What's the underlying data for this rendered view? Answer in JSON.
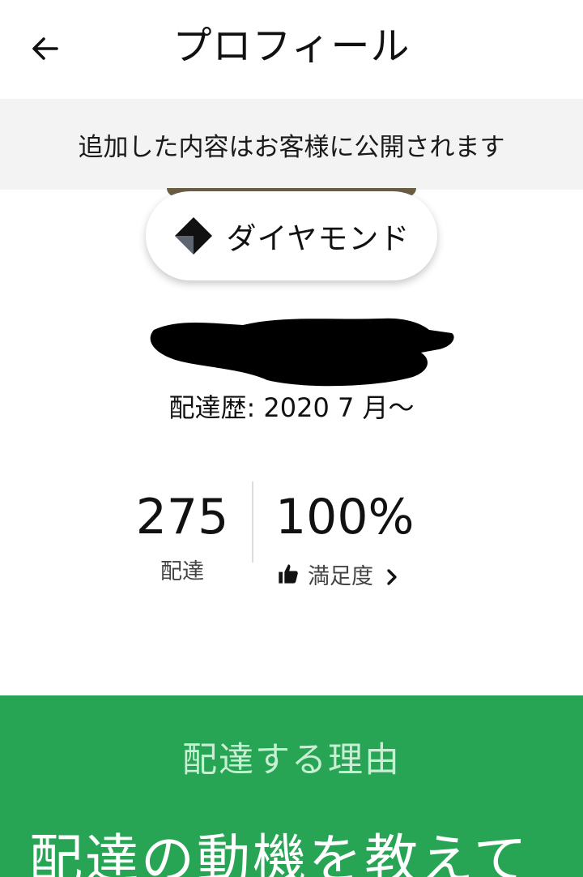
{
  "header": {
    "title": "プロフィール",
    "back_icon": "arrow-left-icon"
  },
  "notice": {
    "text": "追加した内容はお客様に公開されます"
  },
  "tier": {
    "label": "ダイヤモンド",
    "icon": "diamond-icon"
  },
  "profile": {
    "since": "配達歴: 2020 7 月〜"
  },
  "stats": {
    "deliveries": {
      "value": "275",
      "label": "配達"
    },
    "satisfaction": {
      "value": "100%",
      "label": "満足度",
      "icon": "thumbs-up-icon",
      "chevron_icon": "chevron-right-icon"
    }
  },
  "reason": {
    "subtitle": "配達する理由",
    "heading": "配達の動機を教えて"
  },
  "colors": {
    "green": "#27a554",
    "notice_bg": "#f3f3f3",
    "subtitle_green": "#c7efd4"
  }
}
